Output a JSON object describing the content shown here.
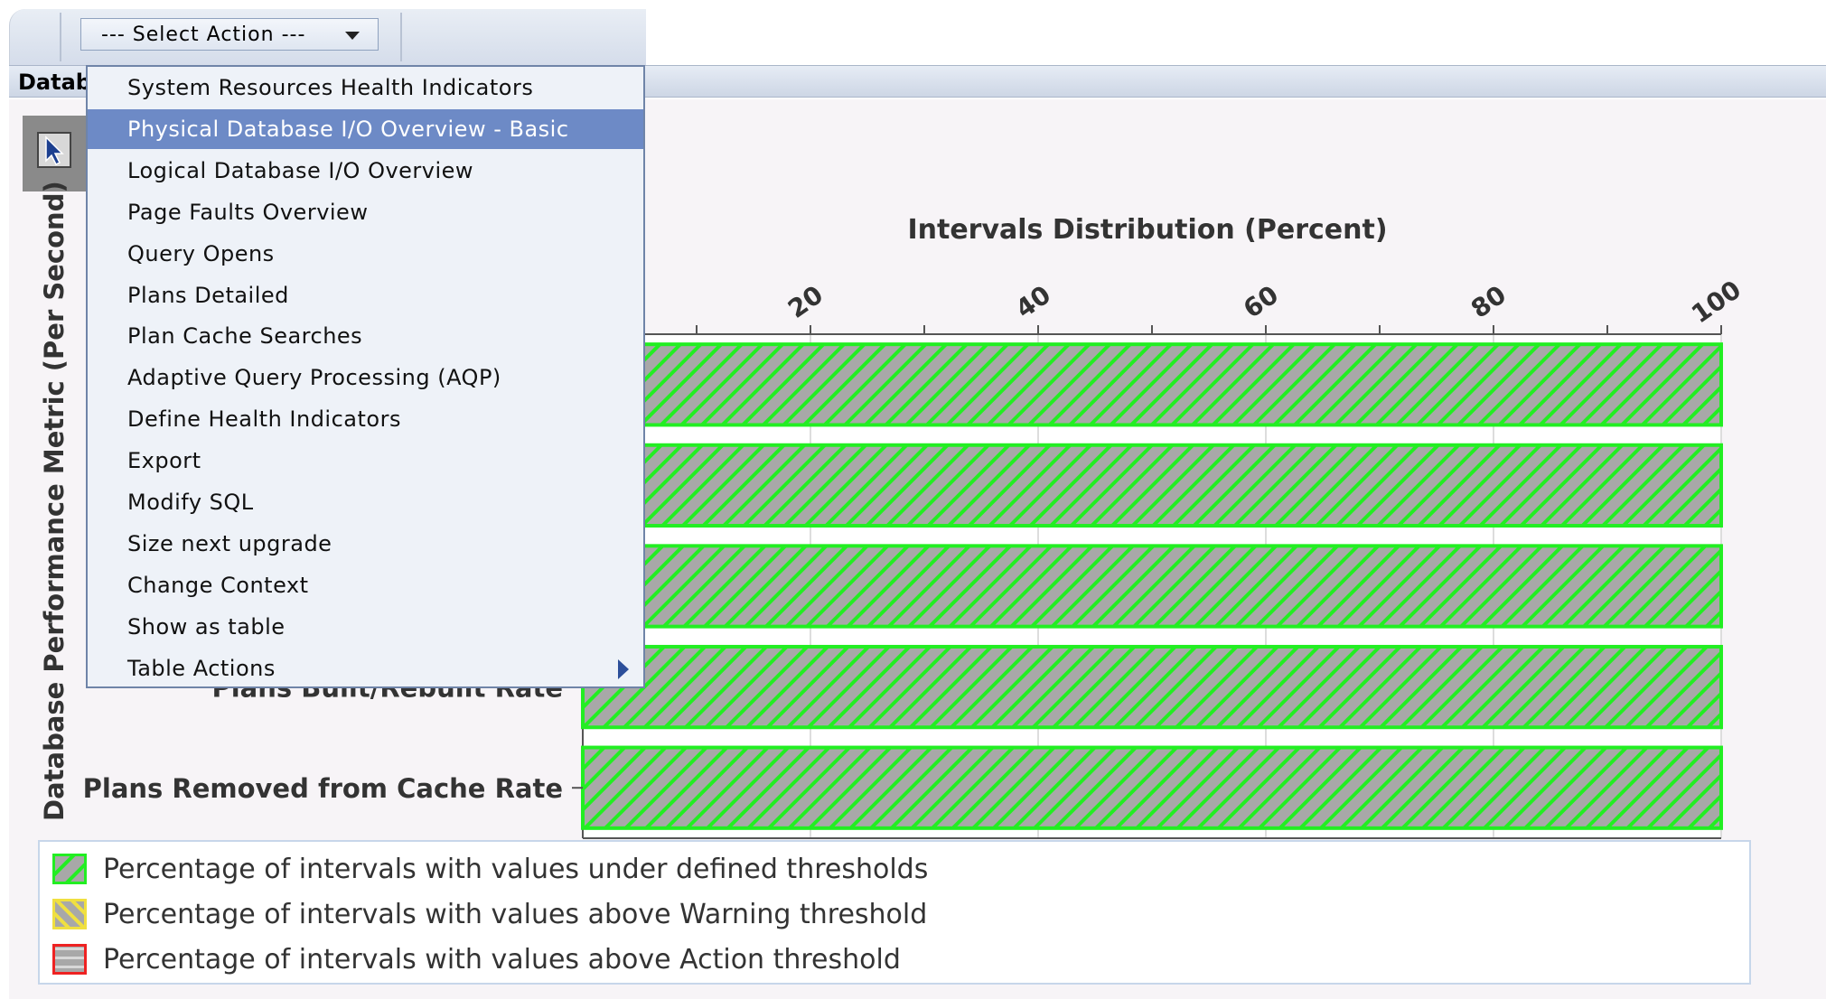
{
  "toolbar": {
    "select_label": "--- Select Action ---"
  },
  "header": {
    "label": "Datab"
  },
  "menu": {
    "items": [
      {
        "label": "System Resources Health Indicators",
        "selected": false,
        "submenu": false
      },
      {
        "label": "Physical Database I/O Overview - Basic",
        "selected": true,
        "submenu": false
      },
      {
        "label": "Logical Database I/O Overview",
        "selected": false,
        "submenu": false
      },
      {
        "label": "Page Faults Overview",
        "selected": false,
        "submenu": false
      },
      {
        "label": "Query Opens",
        "selected": false,
        "submenu": false
      },
      {
        "label": "Plans Detailed",
        "selected": false,
        "submenu": false
      },
      {
        "label": "Plan Cache Searches",
        "selected": false,
        "submenu": false
      },
      {
        "label": "Adaptive Query Processing (AQP)",
        "selected": false,
        "submenu": false
      },
      {
        "label": "Define Health Indicators",
        "selected": false,
        "submenu": false
      },
      {
        "label": "Export",
        "selected": false,
        "submenu": false
      },
      {
        "label": "Modify SQL",
        "selected": false,
        "submenu": false
      },
      {
        "label": "Size next upgrade",
        "selected": false,
        "submenu": false
      },
      {
        "label": "Change Context",
        "selected": false,
        "submenu": false
      },
      {
        "label": "Show as table",
        "selected": false,
        "submenu": false
      },
      {
        "label": "Table Actions",
        "selected": false,
        "submenu": true
      }
    ]
  },
  "chart_data": {
    "type": "bar",
    "orientation": "horizontal",
    "stacked": true,
    "title": "Intervals Distribution (Percent)",
    "ylabel": "Database Performance Metric (Per Second)",
    "xlim": [
      0,
      100
    ],
    "xticks": [
      20,
      40,
      60,
      80,
      100
    ],
    "categories": [
      "",
      "",
      "",
      "Plans Built/Rebuilt Rate",
      "Plans Removed from Cache Rate"
    ],
    "series": [
      {
        "name": "Percentage of intervals with values under defined thresholds",
        "color": "#22ee22",
        "values": [
          100,
          100,
          100,
          100,
          100
        ]
      },
      {
        "name": "Percentage of intervals with values above Warning threshold",
        "color": "#f0e040",
        "values": [
          0,
          0,
          0,
          0,
          0
        ]
      },
      {
        "name": "Percentage of intervals with values above Action threshold",
        "color": "#ee2222",
        "values": [
          0,
          0,
          0,
          0,
          0
        ]
      }
    ],
    "legend_position": "bottom",
    "grid": true
  }
}
